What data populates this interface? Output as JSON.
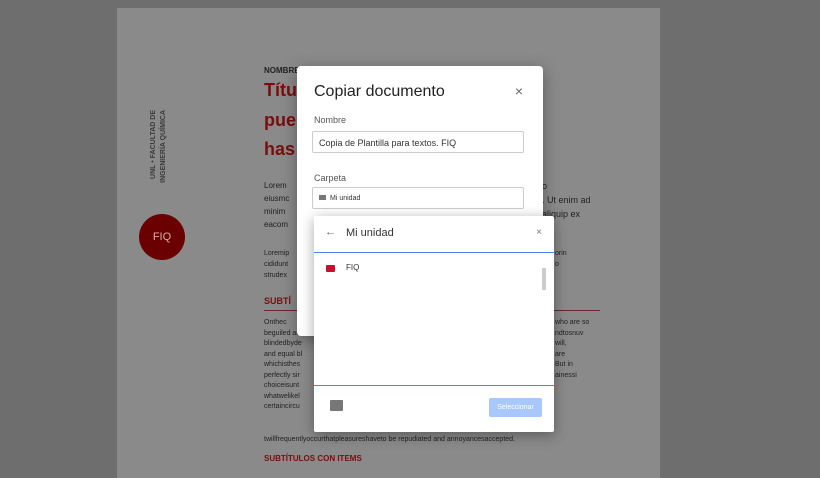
{
  "document": {
    "header_label": "NOMBRE",
    "title_line1": "Títu",
    "title_line2": "pue",
    "title_line3": "has",
    "side_label_line1": "UNL • FACULTAD DE",
    "side_label_line2": "INGENIERÍA QUÍMICA",
    "badge": "FIQ",
    "para1_lines": [
      "Lorem",
      "eiusmc",
      "minim",
      "eacom"
    ],
    "para1_right": [
      "o",
      ". Ut enim ad",
      "aliquip ex"
    ],
    "para2_lines": [
      "Loremip",
      "cididunt",
      "strudex"
    ],
    "para2_right": [
      "orin",
      "o"
    ],
    "subtitle1": "SUBTÍ",
    "para3_left": [
      "Onthec",
      "beguiled anc",
      "blindedbyde",
      "and equal bl",
      "whichisthes",
      "perfectly sir",
      "choiceisunt",
      "whatwelikel",
      "certaincircu"
    ],
    "para3_right": [
      "who are so",
      "",
      "ndtosnuv",
      "will,",
      "are",
      "",
      "",
      "But in",
      "ainessi"
    ],
    "last_line": "twillfrequentlyoccurthatpleasureshaveto be repudiated and annoyancesaccepted.",
    "subtitle2": "SUBTÍTULOS CON ITEMS"
  },
  "dialog": {
    "title": "Copiar documento",
    "close": "×",
    "name_label": "Nombre",
    "name_value": "Copia de Plantilla para textos. FIQ",
    "folder_label": "Carpeta",
    "folder_value": "Mi unidad"
  },
  "picker": {
    "back": "←",
    "title": "Mi unidad",
    "close": "×",
    "items": [
      {
        "label": "FIQ"
      }
    ],
    "select_label": "Seleccionar"
  }
}
